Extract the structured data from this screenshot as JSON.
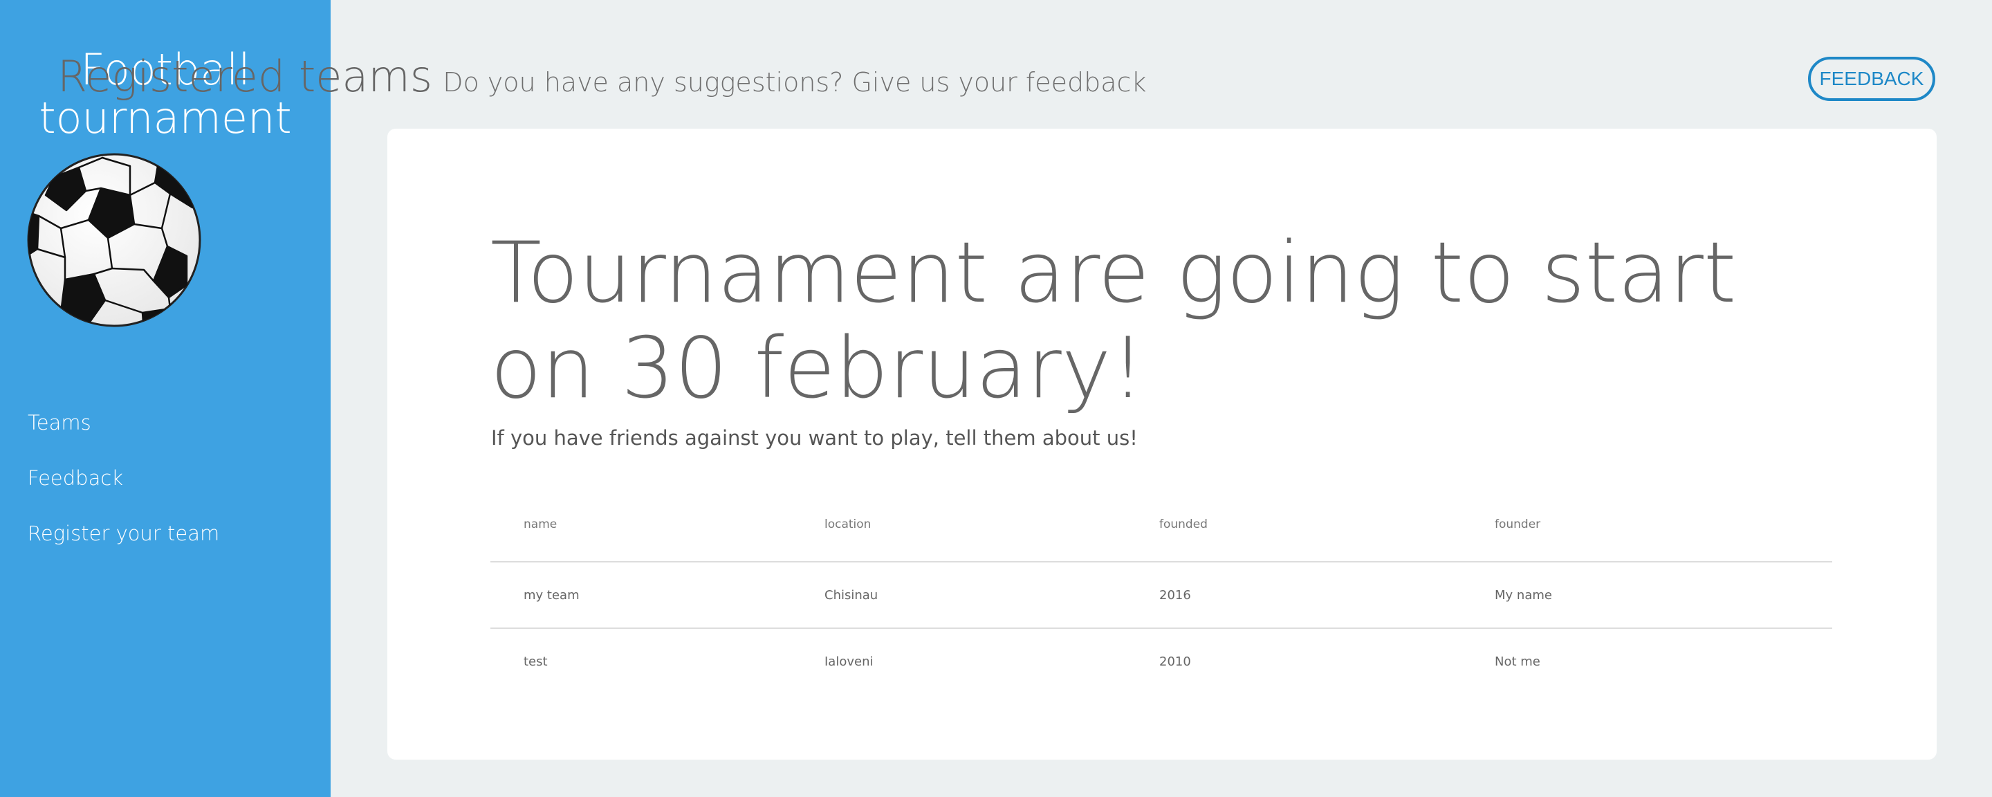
{
  "sidebar": {
    "brand_line1": "Football",
    "brand_line2": "tournament",
    "logo_icon": "soccer-ball-icon",
    "nav": [
      "Teams",
      "Feedback",
      "Register your team"
    ]
  },
  "header": {
    "title": "Registered teams",
    "subtitle": "Do you have any suggestions? Give us your feedback",
    "feedback_button": "FEEDBACK"
  },
  "hero": {
    "line1": "Tournament are going to start",
    "line2": "on 30 february!",
    "subtext": "If you have friends against you want to play, tell them about us!"
  },
  "table": {
    "columns": [
      "name",
      "location",
      "founded",
      "founder"
    ],
    "rows": [
      [
        "my team",
        "Chisinau",
        "2016",
        "My name"
      ],
      [
        "test",
        "Ialoveni",
        "2010",
        "Not me"
      ]
    ]
  },
  "colors": {
    "sidebar_bg": "#3ea2e2",
    "page_bg": "#ecf0f1",
    "accent": "#1e88c7",
    "text": "#666666"
  }
}
